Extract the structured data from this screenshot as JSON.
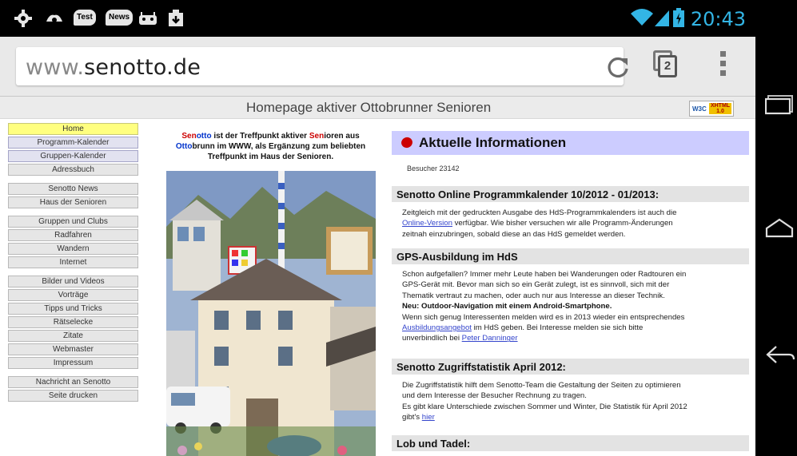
{
  "status": {
    "time": "20:43",
    "badges": [
      "Test",
      "News"
    ],
    "icons": [
      "settings-icon",
      "app-icon",
      "test-notification-icon",
      "news-notification-icon",
      "android-icon",
      "download-icon",
      "wifi-icon",
      "signal-icon",
      "battery-icon"
    ]
  },
  "browser": {
    "url_prefix": "www.",
    "url_domain": "senotto.de",
    "tab_count": "2",
    "icons": [
      "reload-icon",
      "tabs-icon",
      "overflow-menu-icon"
    ]
  },
  "page": {
    "title": "Homepage aktiver Ottobrunner Senioren",
    "badge_w3c": "W3C",
    "badge_html": "XHTML 1.0"
  },
  "nav": {
    "items": [
      {
        "label": "Home",
        "style": "home"
      },
      {
        "label": "Programm-Kalender",
        "style": "hl"
      },
      {
        "label": "Gruppen-Kalender",
        "style": "hl"
      },
      {
        "label": "Adressbuch",
        "style": ""
      },
      {
        "label": "Senotto News",
        "style": "",
        "gap": true
      },
      {
        "label": "Haus der Senioren",
        "style": ""
      },
      {
        "label": "Gruppen und Clubs",
        "style": "",
        "gap": true
      },
      {
        "label": "Radfahren",
        "style": ""
      },
      {
        "label": "Wandern",
        "style": ""
      },
      {
        "label": "Internet",
        "style": ""
      },
      {
        "label": "Bilder und Videos",
        "style": "",
        "gap": true
      },
      {
        "label": "Vorträge",
        "style": ""
      },
      {
        "label": "Tipps und Tricks",
        "style": ""
      },
      {
        "label": "Rätselecke",
        "style": ""
      },
      {
        "label": "Zitate",
        "style": ""
      },
      {
        "label": "Webmaster",
        "style": ""
      },
      {
        "label": "Impressum",
        "style": ""
      },
      {
        "label": "Nachricht an Senotto",
        "style": "",
        "gap": true
      },
      {
        "label": "Seite drucken",
        "style": ""
      }
    ]
  },
  "intro": {
    "p1": "Sen",
    "p2": "otto",
    "p3": " ist der Treffpunkt aktiver ",
    "p4": "Sen",
    "p5": "ioren aus ",
    "p6": "Otto",
    "p7": "brunn im WWW, als Ergänzung zum beliebten Treffpunkt im Haus der Senioren."
  },
  "news": {
    "title": "Aktuelle Informationen",
    "visitors": "Besucher  23142",
    "sections": [
      {
        "heading": "Senotto Online Programmkalender 10/2012 - 01/2013:",
        "lines": [
          {
            "t": "Zeitgleich mit der gedruckten Ausgabe des HdS-Programmkalenders ist auch die"
          },
          {
            "link": "Online-Version",
            "t": " verfügbar. Wie bisher versuchen wir alle Programm-Änderungen"
          },
          {
            "t": "zeitnah einzubringen, sobald diese an das HdS gemeldet werden."
          }
        ]
      },
      {
        "heading": "GPS-Ausbildung im HdS",
        "lines": [
          {
            "t": "Schon aufgefallen? Immer mehr Leute haben bei Wanderungen oder Radtouren ein"
          },
          {
            "t": "GPS-Gerät mit. Bevor man sich so ein Gerät zulegt, ist es sinnvoll, sich mit der"
          },
          {
            "t": "Thematik vertraut zu machen, oder auch nur aus Interesse an dieser Technik."
          },
          {
            "b": "Neu: Outdoor-Navigation mit einem Android-Smartphone."
          },
          {
            "t": "Wenn sich genug Interessenten melden wird es in 2013 wieder ein entsprechendes"
          },
          {
            "link": "Ausbildungsangebot",
            "t": " im HdS geben. Bei Interesse melden sie sich bitte"
          },
          {
            "t": "unverbindlich bei ",
            "link2": "Peter Danninger"
          }
        ]
      },
      {
        "heading": "Senotto Zugriffstatistik April 2012:",
        "lines": [
          {
            "t": "Die Zugriffstatistik hilft dem Senotto-Team die Gestaltung der Seiten zu optimieren"
          },
          {
            "t": "und dem Interesse der Besucher Rechnung zu tragen."
          },
          {
            "t": "Es gibt klare Unterschiede zwischen Sommer und Winter, Die Statistik für April 2012"
          },
          {
            "t": "gibt's ",
            "link2": "hier"
          }
        ]
      },
      {
        "heading": "Lob und Tadel:",
        "lines": []
      }
    ]
  },
  "colors": {
    "clock": "#33b5e5",
    "home": "#ffff80",
    "news_head": "#ccccff",
    "link": "#3344cc"
  }
}
